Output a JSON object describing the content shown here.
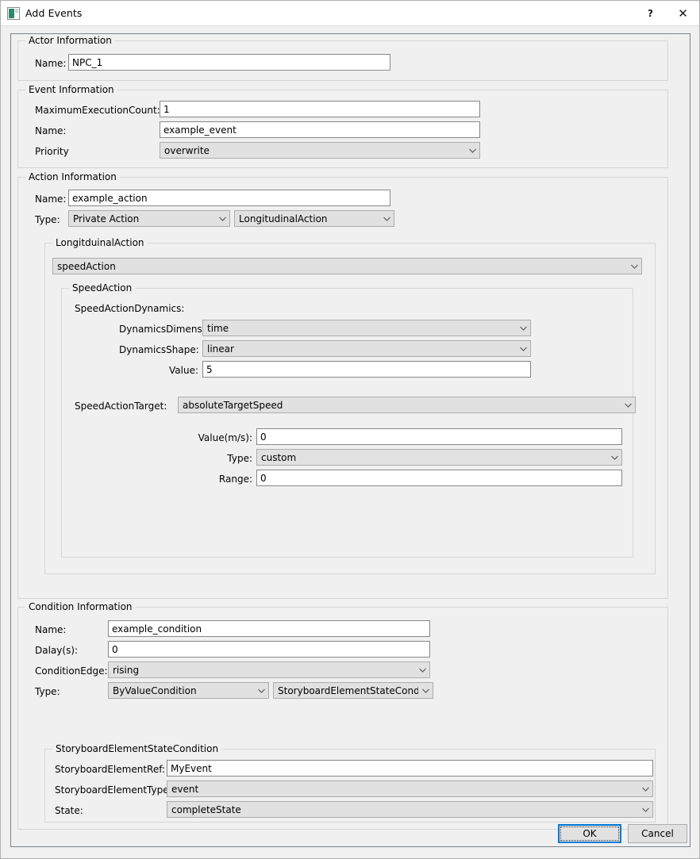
{
  "window": {
    "title": "Add Events",
    "icon": "window-app-icon",
    "help_label": "?",
    "close_label": "✕"
  },
  "actor_information": {
    "legend": "Actor Information",
    "name_label": "Name:",
    "name_value": "NPC_1"
  },
  "event_information": {
    "legend": "Event Information",
    "max_execution_count_label": "MaximumExecutionCount:",
    "max_execution_count_value": "1",
    "name_label": "Name:",
    "name_value": "example_event",
    "priority_label": "Priority",
    "priority_value": "overwrite"
  },
  "action_information": {
    "legend": "Action Information",
    "name_label": "Name:",
    "name_value": "example_action",
    "type_label": "Type:",
    "type_value": "Private Action",
    "subtype_value": "LongitudinalAction",
    "longitudinal": {
      "legend": "LongitduinalAction",
      "action_value": "speedAction",
      "speed_action": {
        "legend": "SpeedAction",
        "dynamics_group_label": "SpeedActionDynamics:",
        "dynamics_dimension_label": "DynamicsDimension:",
        "dynamics_dimension_value": "time",
        "dynamics_shape_label": "DynamicsShape:",
        "dynamics_shape_value": "linear",
        "dynamics_value_label": "Value:",
        "dynamics_value": "5",
        "target_label": "SpeedActionTarget:",
        "target_value": "absoluteTargetSpeed",
        "target_speed_label": "Value(m/s):",
        "target_speed_value": "0",
        "target_type_label": "Type:",
        "target_type_value": "custom",
        "target_range_label": "Range:",
        "target_range_value": "0"
      }
    }
  },
  "condition_information": {
    "legend": "Condition Information",
    "name_label": "Name:",
    "name_value": "example_condition",
    "delay_label": "Dalay(s):",
    "delay_value": "0",
    "condition_edge_label": "ConditionEdge:",
    "condition_edge_value": "rising",
    "type_label": "Type:",
    "type_value": "ByValueCondition",
    "subtype_value": "StoryboardElementStateConditi",
    "storyboard": {
      "legend": "StoryboardElementStateCondition",
      "element_ref_label": "StoryboardElementRef:",
      "element_ref_value": "MyEvent",
      "element_type_label": "StoryboardElementType",
      "element_type_value": "event",
      "state_label": "State:",
      "state_value": "completeState"
    }
  },
  "footer": {
    "ok_label": "OK",
    "cancel_label": "Cancel"
  }
}
